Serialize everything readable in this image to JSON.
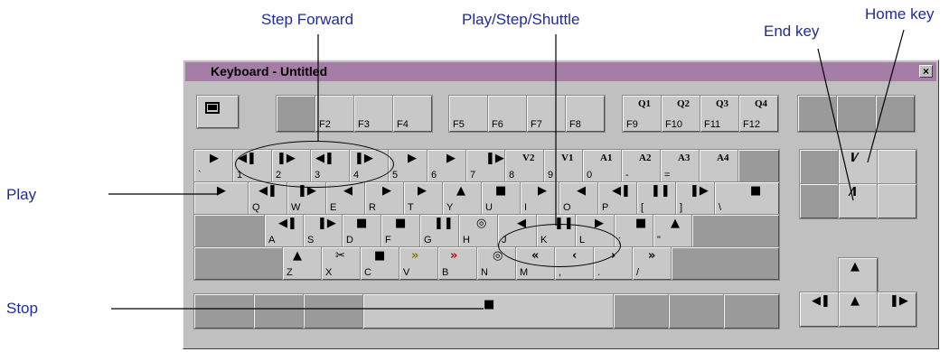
{
  "callouts": {
    "step_forward": "Step Forward",
    "play_step_shuttle": "Play/Step/Shuttle",
    "end_key": "End key",
    "home_key": "Home key",
    "play": "Play",
    "stop": "Stop"
  },
  "window": {
    "title": "Keyboard - Untitled",
    "close_label": "×",
    "title_color": "#a57da6"
  },
  "fkeys": {
    "f2": "F2",
    "f3": "F3",
    "f4": "F4",
    "f5": "F5",
    "f6": "F6",
    "f7": "F7",
    "f8": "F8",
    "f9": "F9",
    "f10": "F10",
    "f11": "F11",
    "f12": "F12",
    "q1": "Q1",
    "q2": "Q2",
    "q3": "Q3",
    "q4": "Q4"
  },
  "row1": {
    "backtick": "`",
    "k1": "1",
    "k2": "2",
    "k3": "3",
    "k4": "4",
    "k5": "5",
    "k6": "6",
    "k7": "7",
    "k8": "8",
    "k9": "9",
    "k0": "0",
    "minus": "-",
    "equals": "=",
    "v2": "V2",
    "v1": "V1",
    "a1": "A1",
    "a2": "A2",
    "a3": "A3",
    "a4": "A4"
  },
  "row2": {
    "q": "Q",
    "w": "W",
    "e": "E",
    "r": "R",
    "t": "T",
    "y": "Y",
    "u": "U",
    "i": "I",
    "o": "O",
    "p": "P",
    "lbracket": "[",
    "rbracket": "]",
    "backslash": "\\"
  },
  "row3": {
    "a": "A",
    "s": "S",
    "d": "D",
    "f": "F",
    "g": "G",
    "h": "H",
    "j": "J",
    "k": "K",
    "l": "L",
    "semicolon": ";",
    "quote": "\""
  },
  "row4": {
    "z": "Z",
    "x": "X",
    "c": "C",
    "v": "V",
    "b": "B",
    "n": "N",
    "m": "M",
    "comma": ",",
    "period": ".",
    "slash": "/"
  },
  "icons": {
    "play": "▶",
    "stop": "■",
    "pause": "❚❚",
    "step_back": "◀❚",
    "step_fwd": "❚▶",
    "rev": "◀",
    "fwd": "▶",
    "rewind": "«",
    "ffwd": "»",
    "lt": "‹",
    "gt": "›",
    "scissors": "✂",
    "target": "◎",
    "up": "▲",
    "home": "I⁄",
    "end": "⁄I"
  }
}
